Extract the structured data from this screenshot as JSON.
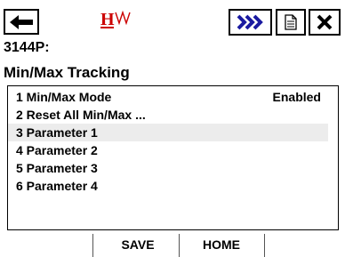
{
  "toolbar": {
    "back_icon": "back-arrow-icon",
    "logo_text": "H",
    "logo_icon": "hart-logo",
    "fast_key_icon": "fast-forward-icon",
    "document_icon": "document-icon",
    "close_icon": "close-icon"
  },
  "device": {
    "tag": "3144P:"
  },
  "page": {
    "title": "Min/Max Tracking"
  },
  "menu": {
    "items": [
      {
        "label": "1 Min/Max Mode",
        "value": "Enabled",
        "selected": false
      },
      {
        "label": "2 Reset All Min/Max ...",
        "value": "",
        "selected": false
      },
      {
        "label": "3 Parameter 1",
        "value": "",
        "selected": true
      },
      {
        "label": "4 Parameter 2",
        "value": "",
        "selected": false
      },
      {
        "label": "5 Parameter 3",
        "value": "",
        "selected": false
      },
      {
        "label": "6 Parameter 4",
        "value": "",
        "selected": false
      }
    ]
  },
  "softkeys": {
    "save": "SAVE",
    "home": "HOME"
  },
  "colors": {
    "logo_red": "#cc0000",
    "selected_row": "#ececec",
    "fast_key_blue": "#1a1aa0"
  }
}
